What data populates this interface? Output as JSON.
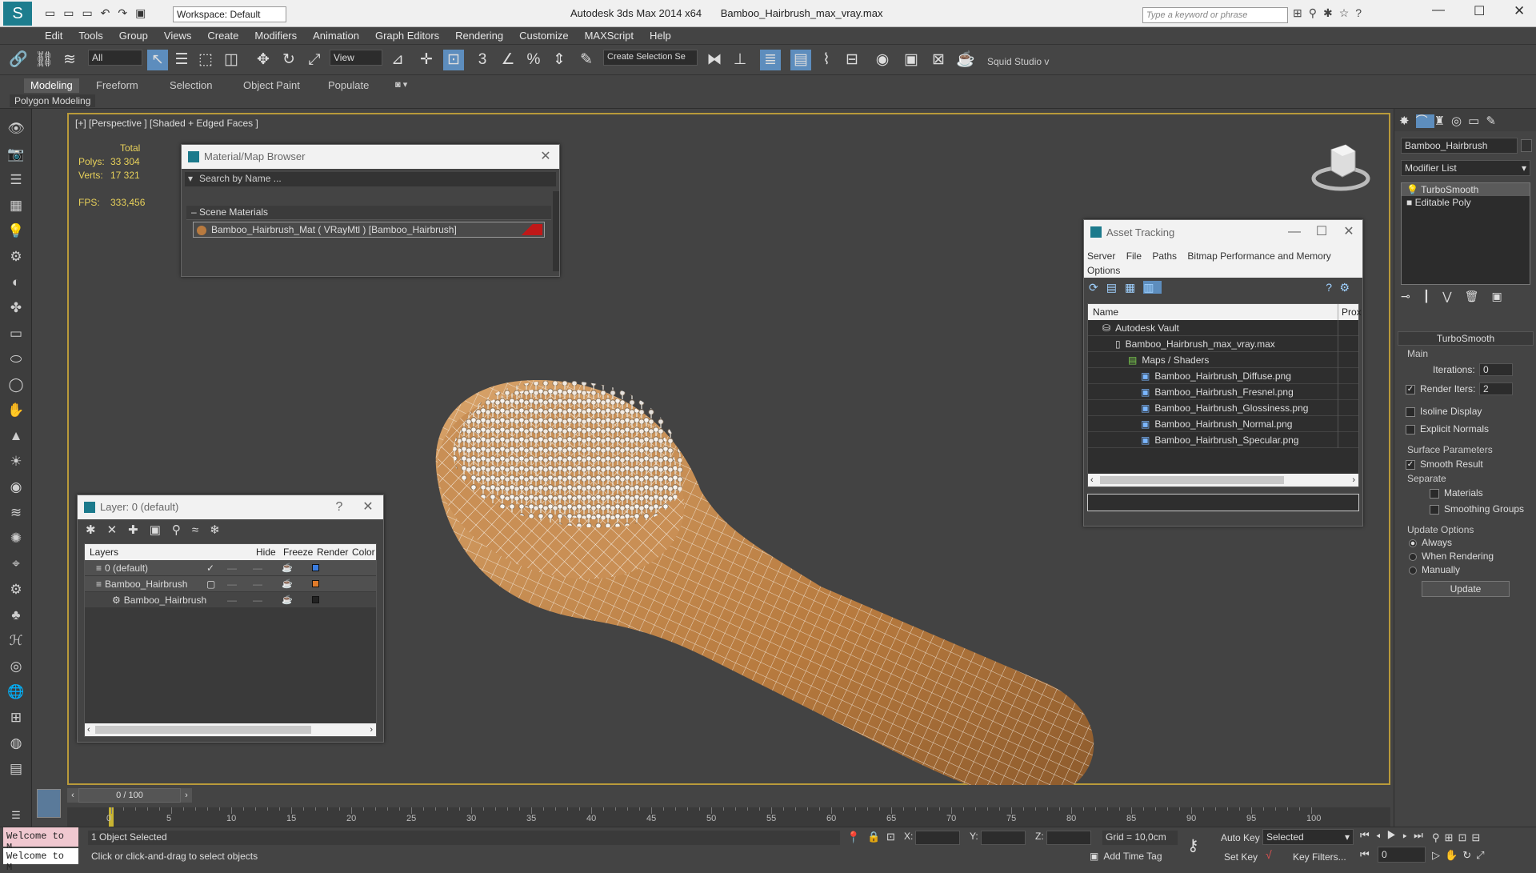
{
  "app": {
    "title": "Autodesk 3ds Max  2014 x64",
    "file": "Bamboo_Hairbrush_max_vray.max",
    "workspace": "Workspace: Default",
    "search_placeholder": "Type a keyword or phrase"
  },
  "menu": [
    "Edit",
    "Tools",
    "Group",
    "Views",
    "Create",
    "Modifiers",
    "Animation",
    "Graph Editors",
    "Rendering",
    "Customize",
    "MAXScript",
    "Help"
  ],
  "toolbar": {
    "filter": "All",
    "view": "View",
    "selection_set": "Create Selection Se",
    "squid": "Squid Studio v"
  },
  "ribbon": {
    "tabs": [
      "Modeling",
      "Freeform",
      "Selection",
      "Object Paint",
      "Populate"
    ],
    "sub": "Polygon Modeling"
  },
  "viewport": {
    "label": "[+] [Perspective ] [Shaded + Edged Faces ]",
    "stats": {
      "total": "Total",
      "polys_label": "Polys:",
      "polys": "33 304",
      "verts_label": "Verts:",
      "verts": "17 321",
      "fps_label": "FPS:",
      "fps": "333,456"
    }
  },
  "material_browser": {
    "title": "Material/Map Browser",
    "search": "Search by Name ...",
    "section": "Scene Materials",
    "item": "Bamboo_Hairbrush_Mat ( VRayMtl ) [Bamboo_Hairbrush]"
  },
  "asset_tracking": {
    "title": "Asset Tracking",
    "menu": [
      "Server",
      "File",
      "Paths",
      "Bitmap Performance and Memory",
      "Options"
    ],
    "col_name": "Name",
    "col_prox": "Prox",
    "rows": [
      "Autodesk Vault",
      "Bamboo_Hairbrush_max_vray.max",
      "Maps / Shaders",
      "Bamboo_Hairbrush_Diffuse.png",
      "Bamboo_Hairbrush_Fresnel.png",
      "Bamboo_Hairbrush_Glossiness.png",
      "Bamboo_Hairbrush_Normal.png",
      "Bamboo_Hairbrush_Specular.png"
    ]
  },
  "layer_window": {
    "title": "Layer: 0 (default)",
    "cols": [
      "Layers",
      "Hide",
      "Freeze",
      "Render",
      "Color"
    ],
    "rows": [
      "0 (default)",
      "Bamboo_Hairbrush",
      "Bamboo_Hairbrush"
    ],
    "colors": [
      "#3b7de0",
      "#e07b2a",
      "#222222"
    ]
  },
  "command_panel": {
    "object_name": "Bamboo_Hairbrush",
    "modifier_list": "Modifier List",
    "stack": [
      "TurboSmooth",
      "Editable Poly"
    ],
    "rollout": "TurboSmooth",
    "main": "Main",
    "iterations_label": "Iterations:",
    "iterations": "0",
    "render_iters_label": "Render Iters:",
    "render_iters": "2",
    "isoline": "Isoline Display",
    "explicit": "Explicit Normals",
    "surface": "Surface Parameters",
    "smooth_result": "Smooth Result",
    "separate": "Separate",
    "materials": "Materials",
    "smoothing_groups": "Smoothing Groups",
    "update_options": "Update Options",
    "always": "Always",
    "when_rendering": "When Rendering",
    "manually": "Manually",
    "update_btn": "Update"
  },
  "timeline": {
    "frame": "0 / 100",
    "ticks": [
      "0",
      "5",
      "10",
      "15",
      "20",
      "25",
      "30",
      "35",
      "40",
      "45",
      "50",
      "55",
      "60",
      "65",
      "70",
      "75",
      "80",
      "85",
      "90",
      "95",
      "100"
    ]
  },
  "status": {
    "welcome": "Welcome to M",
    "selected": "1 Object Selected",
    "prompt": "Click or click-and-drag to select objects",
    "x": "X:",
    "y": "Y:",
    "z": "Z:",
    "grid": "Grid = 10,0cm",
    "add_time_tag": "Add Time Tag",
    "auto_key": "Auto Key",
    "selected_dd": "Selected",
    "set_key": "Set Key",
    "key_filters": "Key Filters...",
    "frame_field": "0"
  }
}
